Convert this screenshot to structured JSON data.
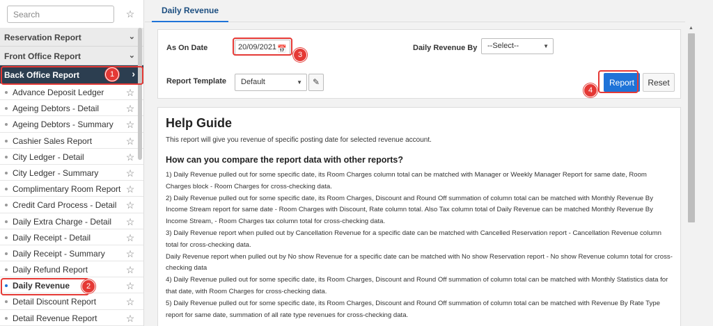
{
  "sidebar": {
    "search": {
      "placeholder": "Search",
      "value": ""
    },
    "sections": [
      {
        "label": "Reservation Report",
        "state": "collapsed"
      },
      {
        "label": "Front Office Report",
        "state": "collapsed"
      },
      {
        "label": "Back Office Report",
        "state": "expanded"
      }
    ],
    "items": [
      {
        "label": "Advance Deposit Ledger"
      },
      {
        "label": "Ageing Debtors - Detail"
      },
      {
        "label": "Ageing Debtors - Summary"
      },
      {
        "label": "Cashier Sales Report"
      },
      {
        "label": "City Ledger - Detail"
      },
      {
        "label": "City Ledger - Summary"
      },
      {
        "label": "Complimentary Room Report"
      },
      {
        "label": "Credit Card Process - Detail"
      },
      {
        "label": "Daily Extra Charge - Detail"
      },
      {
        "label": "Daily Receipt - Detail"
      },
      {
        "label": "Daily Receipt - Summary"
      },
      {
        "label": "Daily Refund Report"
      },
      {
        "label": "Daily Revenue",
        "selected": true
      },
      {
        "label": "Detail Discount Report"
      },
      {
        "label": "Detail Revenue Report"
      }
    ]
  },
  "tabs": [
    {
      "label": "Daily Revenue",
      "active": true
    }
  ],
  "form": {
    "as_on_date_label": "As On Date",
    "as_on_date_value": "20/09/2021",
    "revenue_by_label": "Daily Revenue By",
    "revenue_by_value": "--Select--",
    "template_label": "Report Template",
    "template_value": "Default",
    "report_button": "Report",
    "reset_button": "Reset"
  },
  "annotations": [
    "1",
    "2",
    "3",
    "4"
  ],
  "help": {
    "title": "Help Guide",
    "intro": "This report will give you revenue of specific posting date for selected revenue account.",
    "subtitle": "How can you compare the report data with other reports?",
    "points": [
      "1) Daily Revenue pulled out for some specific date, its Room Charges column total can be matched with Manager or Weekly Manager Report for same date, Room Charges block - Room Charges for cross-checking data.",
      "2) Daily Revenue pulled out for some specific date, its Room Charges, Discount and Round Off summation of column total can be matched with Monthly Revenue By Income Stream report for same date - Room Charges with Discount, Rate column total. Also Tax column total of Daily Revenue can be matched Monthly Revenue By Income Stream, - Room Charges tax column total for cross-checking data.",
      "3) Daily Revenue report when pulled out by Cancellation Revenue for a specific date can be matched with Cancelled Reservation report - Cancellation Revenue column total for cross-checking data.",
      "Daily Revenue report when pulled out by No show Revenue for a specific date can be matched with No show Reservation report - No show Revenue column total for cross-checking data",
      "4) Daily Revenue pulled out for some specific date, its Room Charges, Discount and Round Off summation of column total can be matched with Monthly Statistics data for that date, with Room Charges for cross-checking data.",
      "5) Daily Revenue pulled out for some specific date, its Room Charges, Discount and Round Off summation of column total can be matched with Revenue By Rate Type report for same date, summation of all rate type revenues for cross-checking data."
    ]
  },
  "colors": {
    "accent": "#1e73d8",
    "annotation": "#e53935",
    "active_section": "#2c3e50"
  }
}
